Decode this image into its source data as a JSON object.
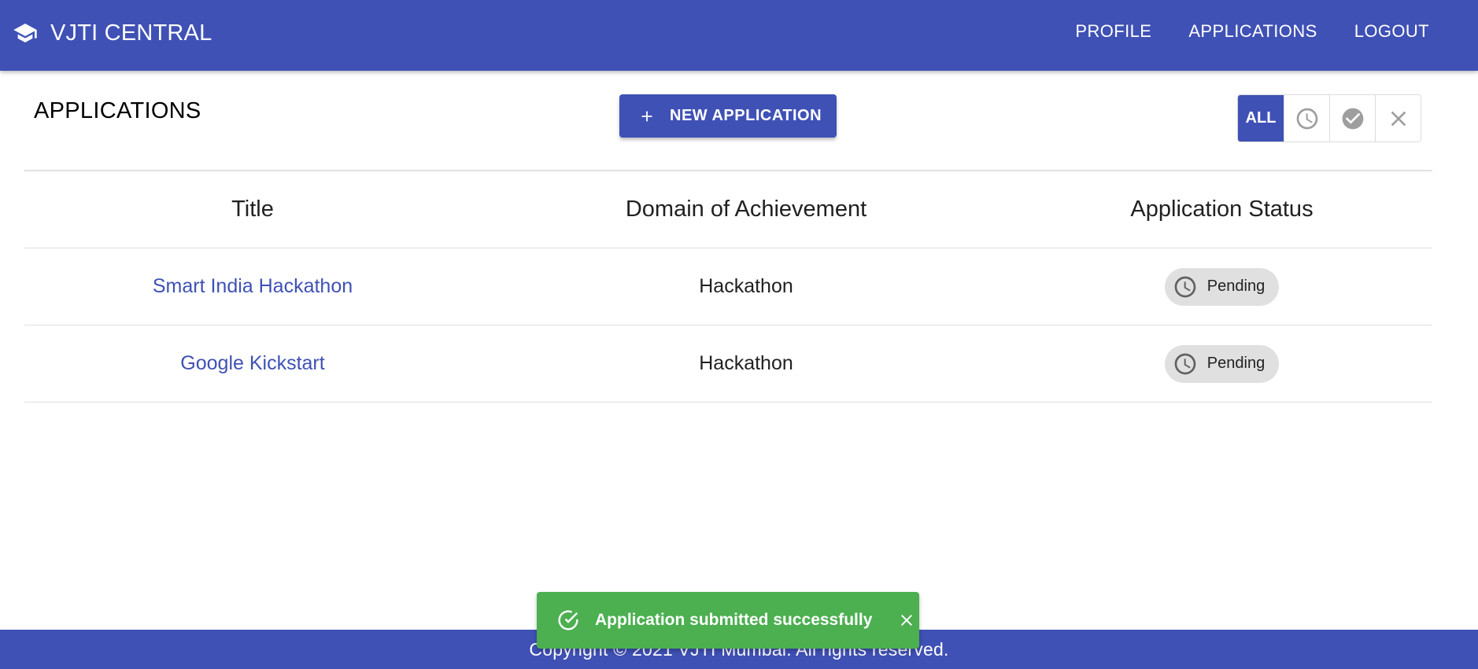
{
  "app": {
    "title": "VJTI CENTRAL",
    "brand_icon": "graduation-cap-icon",
    "colors": {
      "primary": "#3f51b5",
      "success": "#4caf50",
      "chip": "#e0e0e0"
    }
  },
  "nav": {
    "profile": "PROFILE",
    "applications": "APPLICATIONS",
    "logout": "LOGOUT"
  },
  "page": {
    "title": "APPLICATIONS",
    "new_button_label": "NEW APPLICATION",
    "filters": {
      "all": "ALL",
      "selected": "ALL",
      "icons": [
        "clock-icon",
        "check-circle-icon",
        "close-icon"
      ]
    }
  },
  "table": {
    "headers": [
      "Title",
      "Domain of Achievement",
      "Application Status"
    ],
    "rows": [
      {
        "title": "Smart India Hackathon",
        "domain": "Hackathon",
        "status": "Pending"
      },
      {
        "title": "Google Kickstart",
        "domain": "Hackathon",
        "status": "Pending"
      }
    ]
  },
  "snackbar": {
    "message": "Application submitted successfully"
  },
  "footer": {
    "text": "Copyright © 2021 VJTI Mumbai. All rights reserved."
  }
}
